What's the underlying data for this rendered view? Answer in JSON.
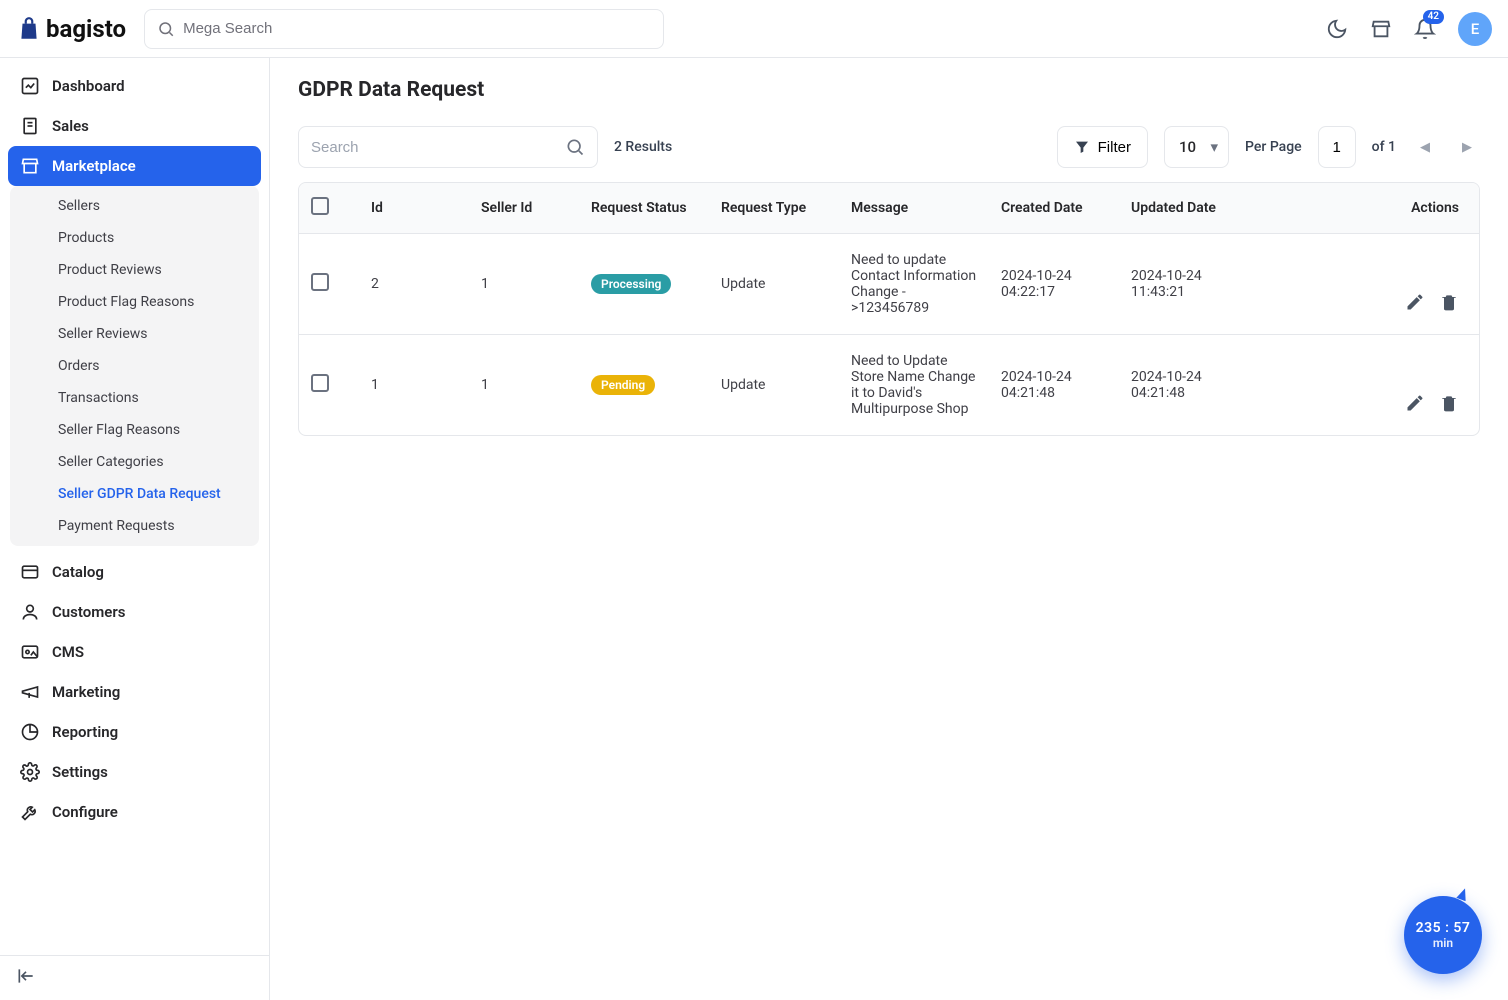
{
  "brand": "bagisto",
  "header": {
    "searchPlaceholder": "Mega Search",
    "notificationCount": "42",
    "avatarInitial": "E"
  },
  "sidebar": {
    "items": [
      {
        "label": "Dashboard"
      },
      {
        "label": "Sales"
      },
      {
        "label": "Marketplace"
      },
      {
        "label": "Catalog"
      },
      {
        "label": "Customers"
      },
      {
        "label": "CMS"
      },
      {
        "label": "Marketing"
      },
      {
        "label": "Reporting"
      },
      {
        "label": "Settings"
      },
      {
        "label": "Configure"
      }
    ],
    "marketplaceSub": [
      {
        "label": "Sellers"
      },
      {
        "label": "Products"
      },
      {
        "label": "Product Reviews"
      },
      {
        "label": "Product Flag Reasons"
      },
      {
        "label": "Seller Reviews"
      },
      {
        "label": "Orders"
      },
      {
        "label": "Transactions"
      },
      {
        "label": "Seller Flag Reasons"
      },
      {
        "label": "Seller Categories"
      },
      {
        "label": "Seller GDPR Data Request"
      },
      {
        "label": "Payment Requests"
      }
    ]
  },
  "page": {
    "title": "GDPR Data Request",
    "searchPlaceholder": "Search",
    "resultsText": "2 Results",
    "filterLabel": "Filter",
    "perPageValue": "10",
    "perPageLabel": "Per Page",
    "currentPage": "1",
    "totalPages": "of 1"
  },
  "table": {
    "columns": {
      "id": "Id",
      "sellerId": "Seller Id",
      "status": "Request Status",
      "type": "Request Type",
      "message": "Message",
      "created": "Created Date",
      "updated": "Updated Date",
      "actions": "Actions"
    },
    "rows": [
      {
        "id": "2",
        "sellerId": "1",
        "status": "Processing",
        "statusClass": "processing",
        "type": "Update",
        "message": "Need to update Contact Information Change - >123456789",
        "created": "2024-10-24 04:22:17",
        "updated": "2024-10-24 11:43:21"
      },
      {
        "id": "1",
        "sellerId": "1",
        "status": "Pending",
        "statusClass": "pending",
        "type": "Update",
        "message": "Need to Update Store Name Change it to David's Multipurpose Shop",
        "created": "2024-10-24 04:21:48",
        "updated": "2024-10-24 04:21:48"
      }
    ]
  },
  "timer": {
    "time": "235 : 57",
    "unit": "min"
  }
}
